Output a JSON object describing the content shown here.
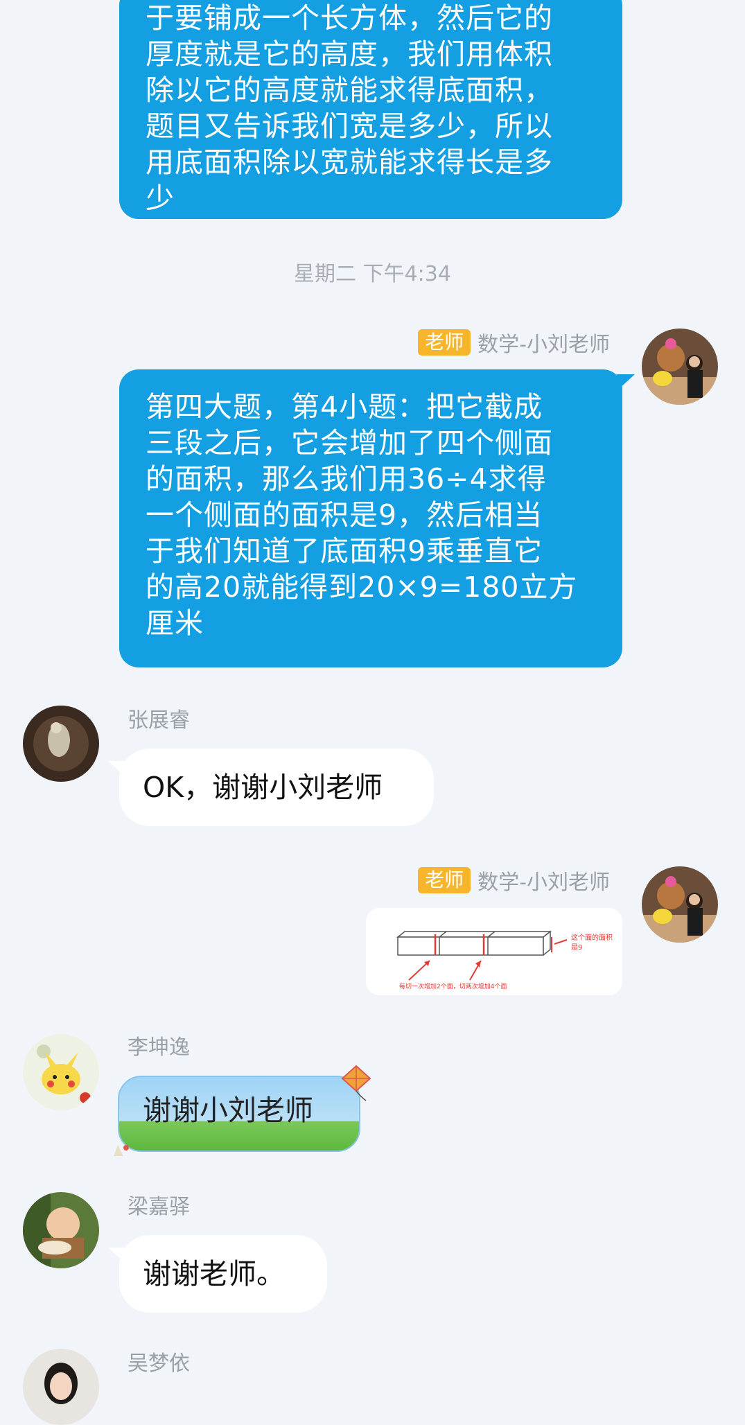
{
  "messages": {
    "m1": {
      "lines": [
        "于要铺成一个长方体，然后它的",
        "厚度就是它的高度，我们用体积",
        "除以它的高度就能求得底面积，",
        "题目又告诉我们宽是多少，所以",
        "用底面积除以宽就能求得长是多",
        "少"
      ]
    },
    "timestamp": "星期二 下午4:34",
    "m2": {
      "badge": "老师",
      "sender": "数学-小刘老师",
      "lines": [
        "第四大题，第4小题：把它截成",
        "三段之后，它会增加了四个侧面",
        "的面积，那么我们用36÷4求得",
        "一个侧面的面积是9，然后相当",
        "于我们知道了底面积9乘垂直它",
        "的高20就能得到20×9=180立方",
        "厘米"
      ]
    },
    "m3": {
      "sender": "张展睿",
      "text": "OK，谢谢小刘老师"
    },
    "m4": {
      "badge": "老师",
      "sender": "数学-小刘老师",
      "image_note_right": "这个面的面积",
      "image_note_right2": "是9",
      "image_note_bottom": "每切一次增加2个面，切两次增加4个面"
    },
    "m5": {
      "sender": "李坤逸",
      "text": "谢谢小刘老师"
    },
    "m6": {
      "sender": "梁嘉驿",
      "text": "谢谢老师。"
    },
    "m7": {
      "sender": "吴梦依"
    }
  },
  "colors": {
    "bubble_blue": "#159fe3",
    "badge": "#f7b52c",
    "background": "#f1f5fa"
  },
  "icons": [
    "teacher-avatar",
    "student-avatar",
    "kite-icon",
    "grass-decoration"
  ]
}
